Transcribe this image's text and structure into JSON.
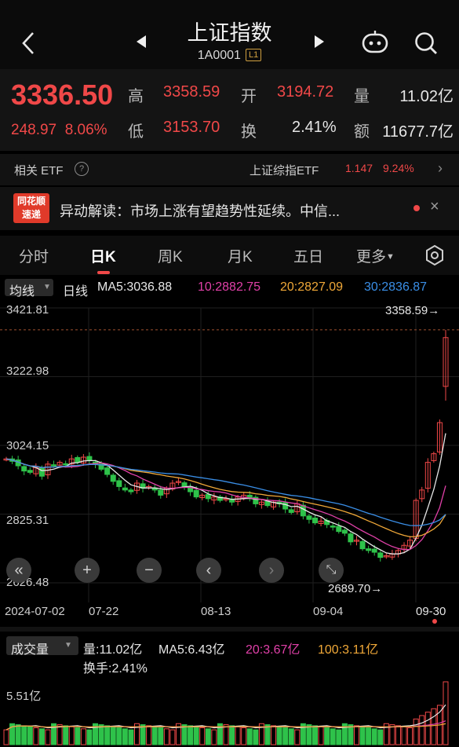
{
  "header": {
    "title": "上证指数",
    "code": "1A0001",
    "level_badge": "L1"
  },
  "quote": {
    "price": "3336.50",
    "change": "248.97",
    "change_pct": "8.06%",
    "high_label": "高",
    "high": "3358.59",
    "open_label": "开",
    "open": "3194.72",
    "volume_label": "量",
    "volume": "11.02亿",
    "low_label": "低",
    "low": "3153.70",
    "turnover_label": "换",
    "turnover": "2.41%",
    "amount_label": "额",
    "amount": "11677.7亿"
  },
  "etf": {
    "label": "相关 ETF",
    "name": "上证综指ETF",
    "price": "1.147",
    "pct": "9.24%"
  },
  "news": {
    "logo_line1": "同花顺",
    "logo_line2": "速递",
    "text": "异动解读：市场上涨有望趋势性延续。中信..."
  },
  "tabs": [
    "分时",
    "日K",
    "周K",
    "月K",
    "五日",
    "更多"
  ],
  "ma_bar": {
    "dropdown": "均线",
    "period": "日线",
    "ma5": "MA5:3036.88",
    "ma10": "10:2882.75",
    "ma20": "20:2827.09",
    "ma30": "30:2836.87"
  },
  "chart_axis": {
    "y_labels": [
      "3421.81",
      "3222.98",
      "3024.15",
      "2825.31",
      "2626.48"
    ],
    "x_labels": [
      "2024-07-02",
      "07-22",
      "08-13",
      "09-04",
      "09-30"
    ],
    "max_marker": "3358.59→",
    "min_marker": "2689.70→"
  },
  "volume_bar": {
    "dropdown": "成交量",
    "vol": "量:11.02亿",
    "ma5": "MA5:6.43亿",
    "ma20": "20:3.67亿",
    "ma100": "100:3.11亿",
    "turnover": "换手:2.41%",
    "y_label": "5.51亿"
  },
  "colors": {
    "up": "#f04848",
    "down": "#2ec24a",
    "ma5": "#e8e8e8",
    "ma10": "#e040a8",
    "ma20": "#f0a838",
    "ma30": "#3a8ee6"
  },
  "chart_data": {
    "type": "candlestick",
    "x_start": "2024-07-02",
    "x_end": "2024-09-30",
    "ylim": [
      2626.48,
      3421.81
    ],
    "closes": [
      2985,
      2978,
      2965,
      2950,
      2946,
      2960,
      2935,
      2970,
      2965,
      2975,
      2970,
      2985,
      2975,
      2990,
      2980,
      2970,
      2955,
      2940,
      2920,
      2905,
      2895,
      2890,
      2915,
      2900,
      2905,
      2895,
      2880,
      2900,
      2915,
      2920,
      2905,
      2890,
      2875,
      2880,
      2870,
      2875,
      2865,
      2870,
      2860,
      2875,
      2880,
      2870,
      2855,
      2860,
      2850,
      2860,
      2855,
      2840,
      2830,
      2855,
      2820,
      2810,
      2800,
      2805,
      2795,
      2790,
      2775,
      2770,
      2745,
      2750,
      2725,
      2720,
      2715,
      2700,
      2705,
      2710,
      2720,
      2735,
      2750,
      2865,
      2895,
      2975,
      3000,
      3090,
      3336
    ],
    "volume_max": 11.02
  }
}
